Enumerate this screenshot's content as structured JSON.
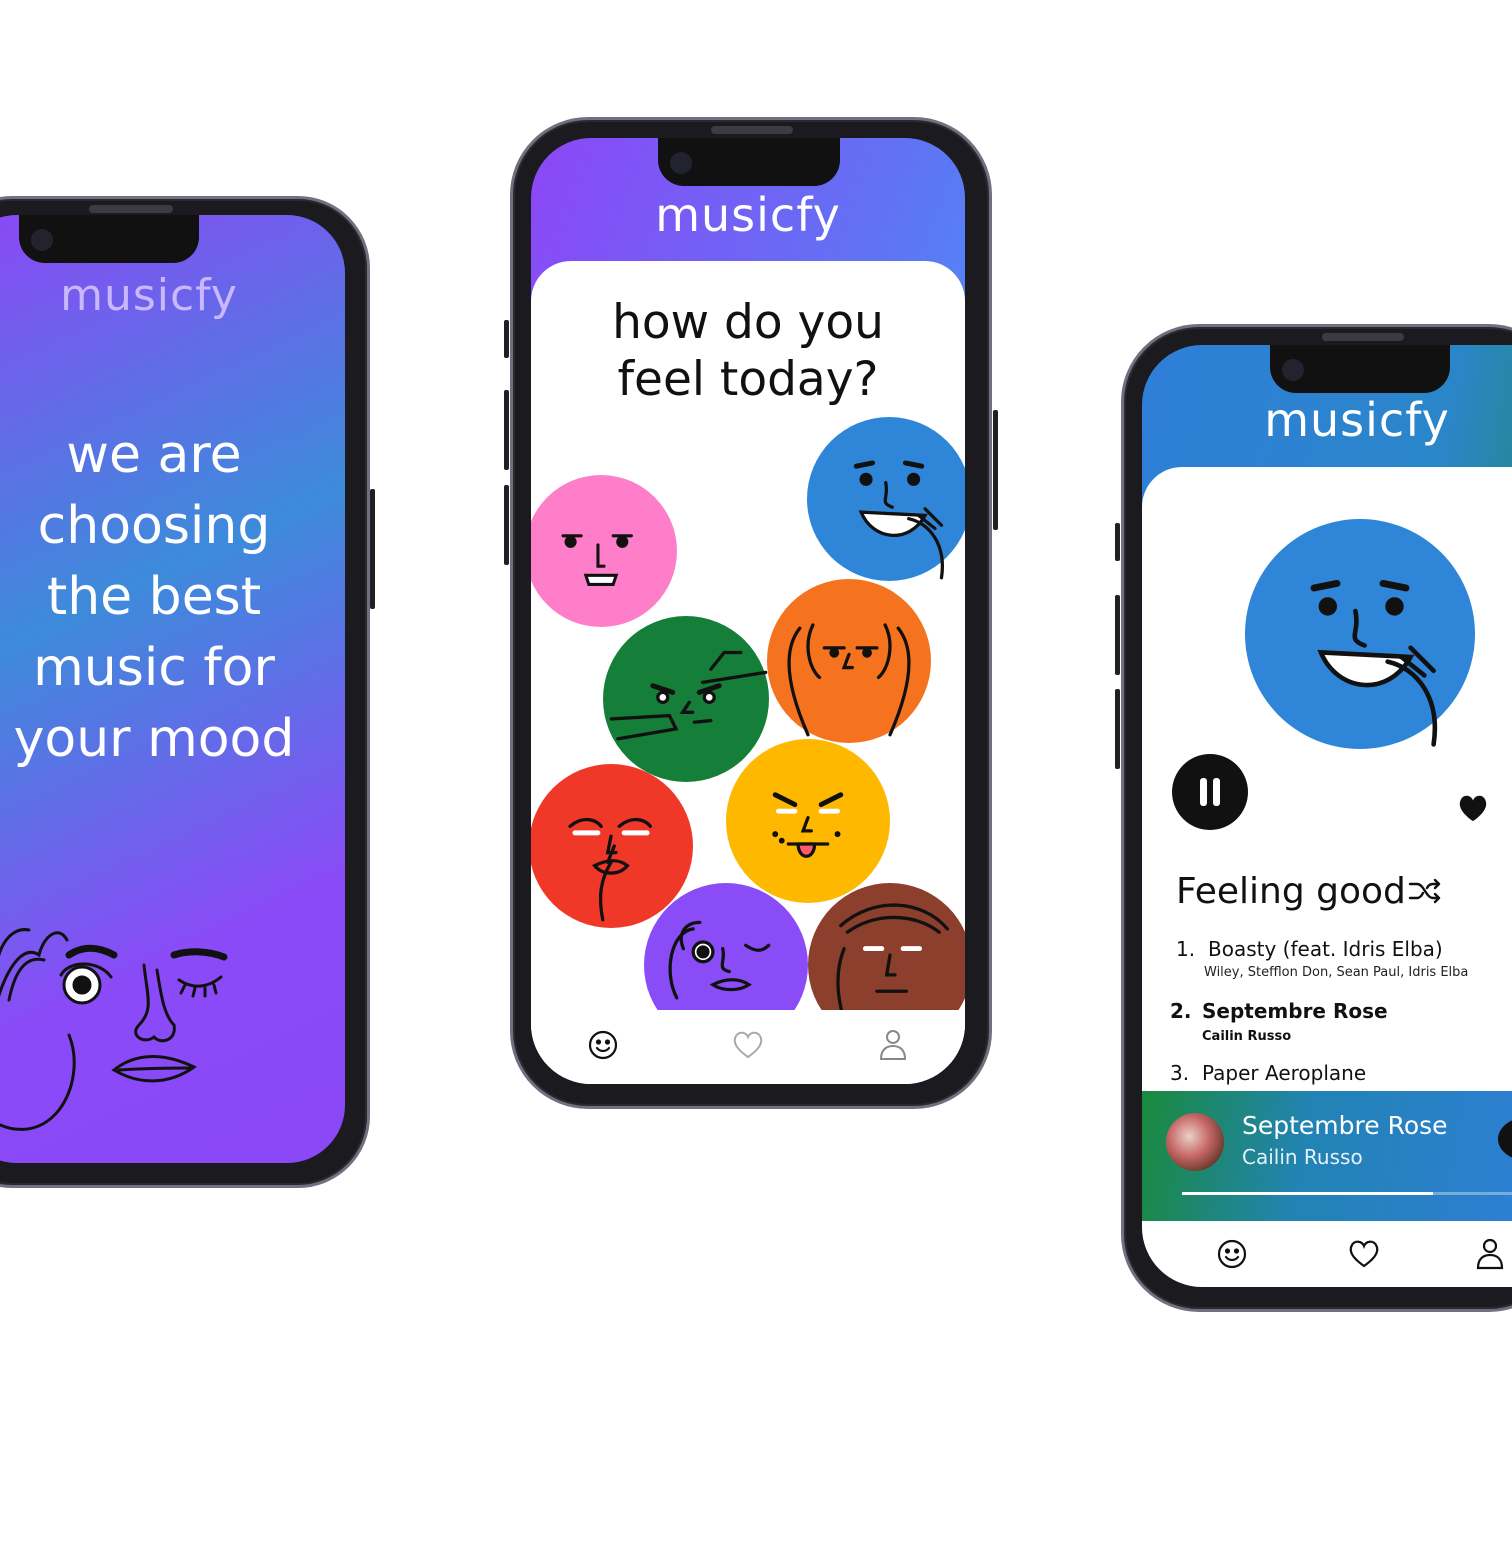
{
  "app": {
    "name": "musicfy"
  },
  "splash": {
    "brand": "musicfy",
    "tagline_lines": [
      "we are",
      "choosing",
      "the best",
      "music for",
      "your mood"
    ],
    "background_gradient": [
      "#7b45f5",
      "#3a8ed8",
      "#8a48f7"
    ]
  },
  "mood_select": {
    "brand": "musicfy",
    "question_lines": [
      "how do you",
      "feel today?"
    ],
    "moods": [
      {
        "name": "happy",
        "color": "#2f86d8"
      },
      {
        "name": "silly",
        "color": "#ff7ec9"
      },
      {
        "name": "focused",
        "color": "#157f39"
      },
      {
        "name": "shocked",
        "color": "#f5721f"
      },
      {
        "name": "quiet",
        "color": "#f03829"
      },
      {
        "name": "cheeky",
        "color": "#ffb800"
      },
      {
        "name": "curious",
        "color": "#8a4cf7"
      },
      {
        "name": "tired",
        "color": "#8b3f2c"
      }
    ],
    "tabs": [
      {
        "name": "mood-tab",
        "icon": "smiley-icon",
        "active": true
      },
      {
        "name": "favorites-tab",
        "icon": "heart-icon",
        "active": false
      },
      {
        "name": "profile-tab",
        "icon": "user-icon",
        "active": false
      }
    ]
  },
  "player": {
    "brand": "musicfy",
    "playlist_title": "Feeling good",
    "tracks": [
      {
        "number": "1.",
        "title": "Boasty (feat. Idris Elba)",
        "artists": "Wiley, Stefflon Don, Sean Paul, Idris Elba",
        "current": false
      },
      {
        "number": "2.",
        "title": "Septembre Rose",
        "artists": "Cailin Russo",
        "current": true
      },
      {
        "number": "3.",
        "title": "Paper Aeroplane",
        "artists": "",
        "current": false
      }
    ],
    "now_playing": {
      "title": "Septembre Rose",
      "artist": "Cailin Russo",
      "progress": 0.66
    },
    "accent_colors": [
      "#2f7ed8",
      "#1a8a3c"
    ]
  }
}
